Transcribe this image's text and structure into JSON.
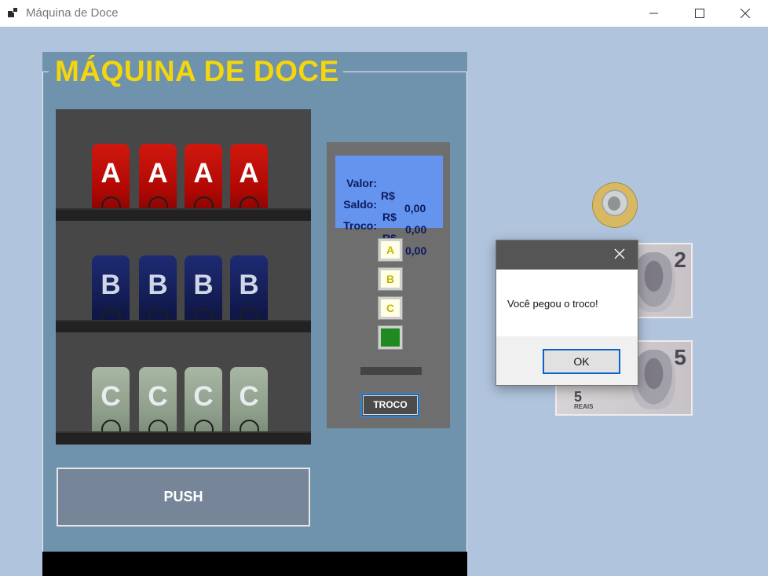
{
  "window": {
    "title": "Máquina de Doce"
  },
  "machine": {
    "title": "MÁQUINA DE DOCE",
    "rows": [
      {
        "letter": "A",
        "count": 4,
        "color": "#b00804"
      },
      {
        "letter": "B",
        "count": 4,
        "color": "#131c52"
      },
      {
        "letter": "C",
        "count": 4,
        "color": "#8d9e8a"
      }
    ],
    "push_label": "PUSH"
  },
  "display": {
    "valor_label": "Valor:",
    "valor_currency": "R$",
    "valor_amount": "0,00",
    "saldo_label": "Saldo:",
    "saldo_currency": "R$",
    "saldo_amount": "0,00",
    "troco_label": "Troco:",
    "troco_currency": "R$",
    "troco_amount": "0,00"
  },
  "controls": {
    "select_a": "A",
    "select_b": "B",
    "select_c": "C",
    "troco_button": "TROCO"
  },
  "money": {
    "note_2": {
      "value": "2"
    },
    "note_5": {
      "value": "5",
      "text": "REAIS"
    }
  },
  "dialog": {
    "message": "Você pegou o troco!",
    "ok_label": "OK"
  },
  "colors": {
    "title_yellow": "#f4d60c",
    "panel_blue": "#6f92ad",
    "background": "#b0c4de",
    "display_blue": "#6494ed"
  }
}
